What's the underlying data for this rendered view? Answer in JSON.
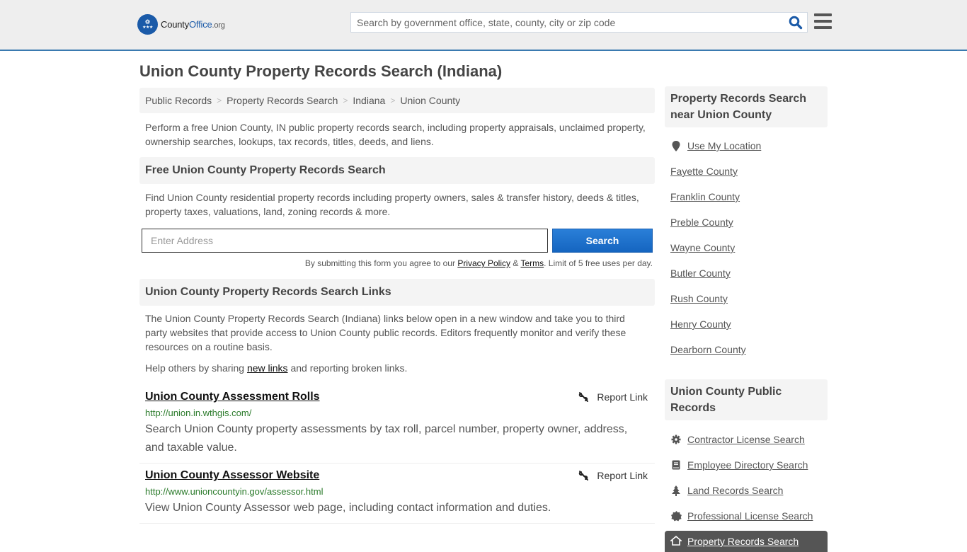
{
  "header": {
    "logo": {
      "name_part1": "County",
      "name_part2": "Office",
      "tld": ".org"
    },
    "search_placeholder": "Search by government office, state, county, city or zip code",
    "search_icon": "search-icon",
    "menu_icon": "hamburger-menu-icon",
    "accent_color": "#3a7ab0"
  },
  "page": {
    "title": "Union County Property Records Search (Indiana)"
  },
  "breadcrumb": [
    {
      "label": "Public Records"
    },
    {
      "label": "Property Records Search"
    },
    {
      "label": "Indiana"
    },
    {
      "label": "Union County"
    }
  ],
  "intro": "Perform a free Union County, IN public property records search, including property appraisals, unclaimed property, ownership searches, lookups, tax records, titles, deeds, and liens.",
  "free_search": {
    "heading": "Free Union County Property Records Search",
    "description": "Find Union County residential property records including property owners, sales & transfer history, deeds & titles, property taxes, valuations, land, zoning records & more.",
    "address_placeholder": "Enter Address",
    "button_label": "Search",
    "terms_prefix": "By submitting this form you agree to our ",
    "privacy_label": "Privacy Policy",
    "amp": " & ",
    "terms_label": "Terms",
    "terms_suffix": ". Limit of 5 free uses per day."
  },
  "links_section": {
    "heading": "Union County Property Records Search Links",
    "description": "The Union County Property Records Search (Indiana) links below open in a new window and take you to third party websites that provide access to Union County public records. Editors frequently monitor and verify these resources on a routine basis.",
    "help_prefix": "Help others by sharing ",
    "help_link": "new links",
    "help_suffix": " and reporting broken links.",
    "report_label": "Report Link",
    "items": [
      {
        "title": "Union County Assessment Rolls",
        "url": "http://union.in.wthgis.com/",
        "description": "Search Union County property assessments by tax roll, parcel number, property owner, address, and taxable value."
      },
      {
        "title": "Union County Assessor Website",
        "url": "http://www.unioncountyin.gov/assessor.html",
        "description": "View Union County Assessor web page, including contact information and duties."
      }
    ]
  },
  "sidebar": {
    "nearby": {
      "heading": "Property Records Search near Union County",
      "use_location": "Use My Location",
      "counties": [
        "Fayette County",
        "Franklin County",
        "Preble County",
        "Wayne County",
        "Butler County",
        "Rush County",
        "Henry County",
        "Dearborn County"
      ]
    },
    "public_records": {
      "heading": "Union County Public Records",
      "items": [
        {
          "label": "Contractor License Search",
          "icon": "gear-icon"
        },
        {
          "label": "Employee Directory Search",
          "icon": "book-icon"
        },
        {
          "label": "Land Records Search",
          "icon": "tree-icon"
        },
        {
          "label": "Professional License Search",
          "icon": "badge-icon"
        }
      ],
      "active_item": {
        "label": "Property Records Search",
        "icon": "home-icon"
      }
    }
  }
}
